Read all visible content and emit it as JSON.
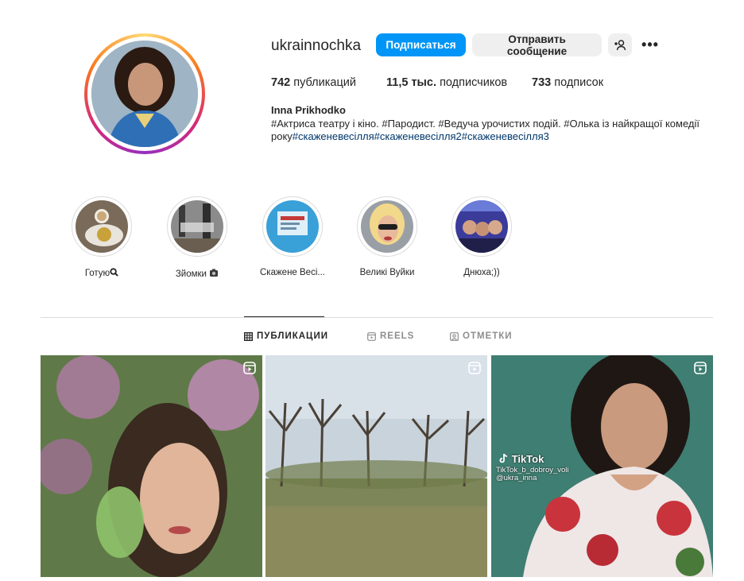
{
  "profile": {
    "username": "ukrainnochka",
    "follow_label": "Подписаться",
    "message_label": "Отправить сообщение",
    "stats": {
      "posts_count": "742",
      "posts_label": "публикаций",
      "followers_count": "11,5 тыс.",
      "followers_label": "подписчиков",
      "following_count": "733",
      "following_label": "подписок"
    },
    "full_name": "Inna Prikhodko",
    "bio_text": "#Актриса театру і кіно. #Пародист. #Ведуча урочистих подій. #Олька із найкращої комедії року",
    "bio_tags": [
      "#скаженевесілля",
      "#скаженевесілля2",
      "#скаженевесілля3"
    ]
  },
  "highlights": [
    {
      "label": "Готую"
    },
    {
      "label": "Зйомки"
    },
    {
      "label": "Скажене Весі..."
    },
    {
      "label": "Великі Вуйки"
    },
    {
      "label": "Днюха;))"
    }
  ],
  "tabs": [
    {
      "label": "ПУБЛИКАЦИИ",
      "icon": "grid-icon",
      "active": true
    },
    {
      "label": "REELS",
      "icon": "reels-icon",
      "active": false
    },
    {
      "label": "ОТМЕТКИ",
      "icon": "tagged-icon",
      "active": false
    }
  ],
  "posts": [
    {
      "type": "reel",
      "subject": "woman-with-flowers"
    },
    {
      "type": "reel",
      "subject": "spring-trees-field"
    },
    {
      "type": "reel",
      "subject": "woman-floral-dress",
      "overlay_logo": "TikTok",
      "overlay_user_1": "TikTok_b_dobroy_voli",
      "overlay_user_2": "@ukra_inna"
    }
  ],
  "colors": {
    "accent": "#0095f6",
    "text": "#262626",
    "link": "#00376b",
    "muted": "#8e8e8e",
    "border": "#dbdbdb"
  }
}
